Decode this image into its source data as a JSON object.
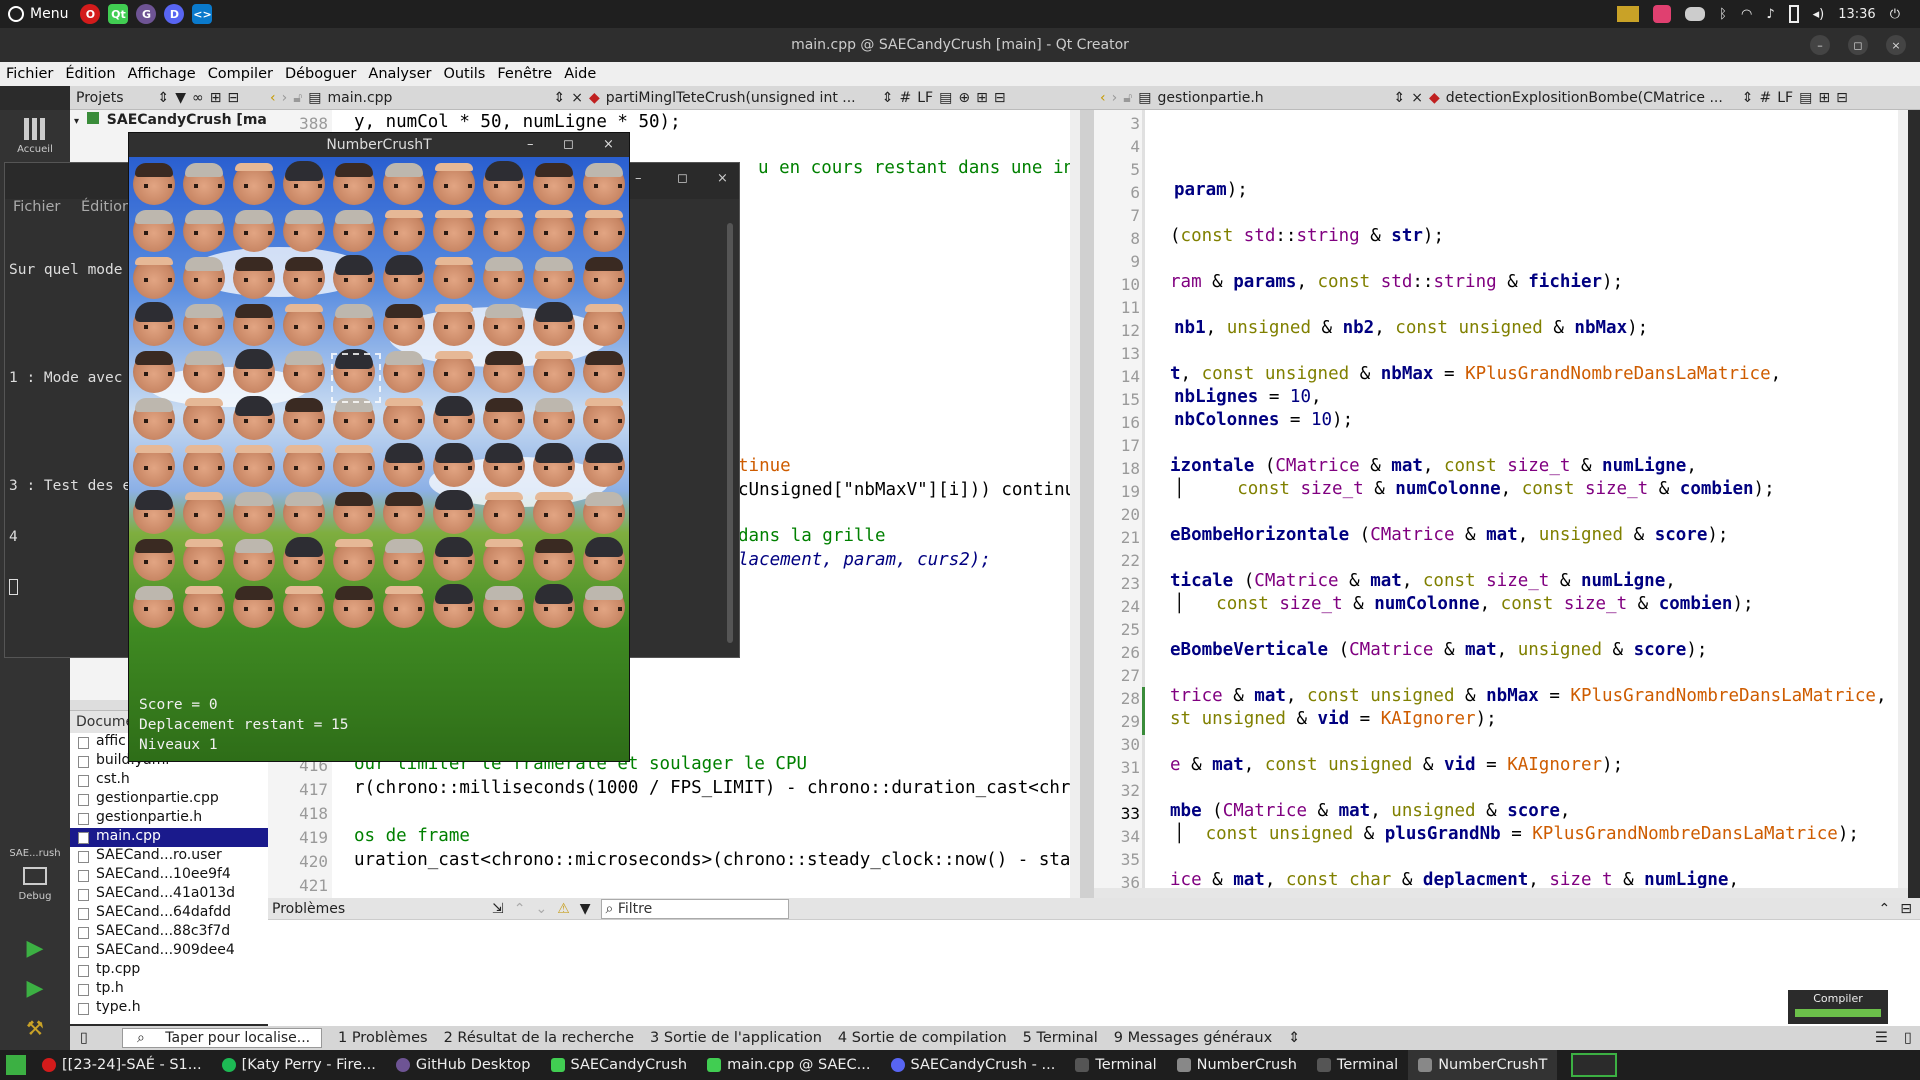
{
  "system_panel": {
    "menu_label": "Menu",
    "apps": [
      "opera-icon",
      "qt-icon",
      "github-icon",
      "discord-icon",
      "vscode-icon"
    ],
    "clock": "13:36"
  },
  "qt_window": {
    "title": "main.cpp @ SAECandyCrush [main] - Qt Creator",
    "menu": [
      "Fichier",
      "Édition",
      "Affichage",
      "Compiler",
      "Déboguer",
      "Analyser",
      "Outils",
      "Fenêtre",
      "Aide"
    ]
  },
  "toolbar": {
    "projects_label": "Projets",
    "left_file": "main.cpp",
    "left_symbol": "partiMinglTeteCrush(unsigned int ...",
    "left_hash": "#",
    "left_eol": "LF",
    "right_file": "gestionpartie.h",
    "right_symbol": "detectionExplositionBombe(CMatrice ...",
    "right_hash": "#",
    "right_eol": "LF"
  },
  "modebar": {
    "welcome_label": "Accueil",
    "kit_label": "SAE...rush",
    "debug_label": "Debug"
  },
  "project_tree": {
    "root": "SAECandyCrush [main"
  },
  "documents": {
    "header": "Docume",
    "items": [
      "affic",
      "build.yaml",
      "cst.h",
      "gestionpartie.cpp",
      "gestionpartie.h",
      "main.cpp",
      "SAECand...ro.user",
      "SAECand...10ee9f4",
      "SAECand...41a013d",
      "SAECand...64dafdd",
      "SAECand...88c3f7d",
      "SAECand...909dee4",
      "tp.cpp",
      "tp.h",
      "type.h"
    ],
    "selected": "main.cpp"
  },
  "editor_left": {
    "line_numbers": [
      "388",
      "416",
      "417",
      "418",
      "419",
      "420",
      "421"
    ],
    "lines": {
      "l388": "y, numCol * 50, numLigne * 50);",
      "l_comment": "u en cours restant dans une inte",
      "l_continue": "tinue",
      "l_unsigned": "cUnsigned[\"nbMaxV\"][i])) continu",
      "l_grille": "dans la grille",
      "l_deplacement": "lacement, param, curs2);",
      "l416": "our limiter le framerate et soulager le CPU",
      "l417": "r(chrono::milliseconds(1000 / FPS_LIMIT) - chrono::duration_cast<chr",
      "l419": "os de frame",
      "l420": "uration_cast<chrono::microseconds>(chrono::steady_clock::now() - sta"
    }
  },
  "editor_right": {
    "line_numbers": [
      "3",
      "4",
      "5",
      "6",
      "7",
      "8",
      "9",
      "10",
      "11",
      "12",
      "13",
      "14",
      "15",
      "16",
      "17",
      "18",
      "19",
      "20",
      "21",
      "22",
      "23",
      "24",
      "25",
      "26",
      "27",
      "28",
      "29",
      "30",
      "31",
      "32",
      "33",
      "34",
      "35",
      "36"
    ],
    "current_line": "33"
  },
  "issues": {
    "title": "Problèmes",
    "filter_placeholder": "Filtre"
  },
  "terminal": {
    "menu": [
      "Fichier",
      "Édition"
    ],
    "lines": [
      "Sur quel mode",
      "",
      "1 : Mode avec",
      "",
      "3 : Test des e",
      "4"
    ]
  },
  "game": {
    "title": "NumberCrushT",
    "score": "Score = 0",
    "moves": "Deplacement restant = 15",
    "level": "Niveaux 1"
  },
  "output_tabs": {
    "locator_placeholder": "Taper pour localise...",
    "tabs": [
      "1 Problèmes",
      "2 Résultat de la recherche",
      "3 Sortie de l'application",
      "4 Sortie de compilation",
      "5 Terminal",
      "9 Messages généraux"
    ]
  },
  "compile_badge": "Compiler",
  "taskbar": {
    "items": [
      "[[23-24]-SAÉ - S1...",
      "[Katy Perry - Fire...",
      "GitHub Desktop",
      "SAECandyCrush",
      "main.cpp @ SAEC...",
      "SAECandyCrush - ...",
      "Terminal",
      "NumberCrush",
      "Terminal",
      "NumberCrushT"
    ]
  },
  "colors": {
    "keyword": "#808000",
    "type": "#800080",
    "identifier": "#000080",
    "comment": "#008000",
    "constant": "#ce5c00",
    "selection": "#1a1a8c"
  }
}
